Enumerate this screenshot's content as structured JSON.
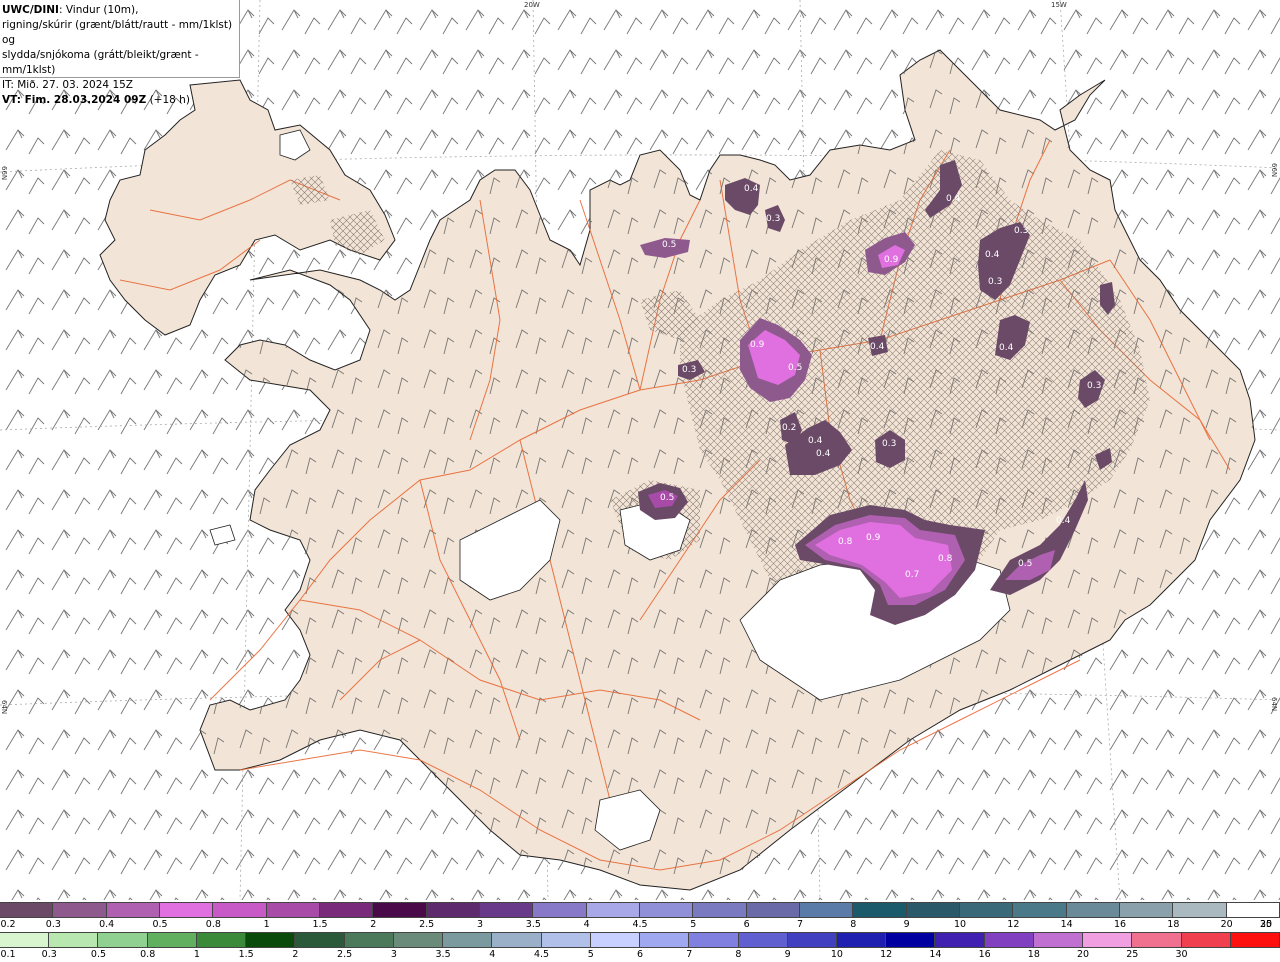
{
  "infobox": {
    "model": "UWC/DINI",
    "line1_rest": ": Vindur (10m),",
    "line2": "rigning/skúrir (grænt/blátt/rautt - mm/1klst) og",
    "line3": "slydda/snjókoma (grátt/bleikt/grænt - mm/1klst)",
    "line4": "IT: Mið. 27. 03. 2024 15Z",
    "line5": "VT: Fim. 28.03.2024 09Z",
    "line5_rest": " (+18 h)"
  },
  "grid_labels": {
    "lon_20w": "20W",
    "lon_15w": "15W",
    "lat_66n_left": "66N",
    "lat_66n_right": "66N",
    "lat_64n_left": "64N",
    "lat_64n_right": "64N"
  },
  "colors": {
    "land": "#f2e4d6",
    "sea": "#ffffff",
    "roads": "#e8602a",
    "hatch": "#8a7a70",
    "glacier": "#ffffff"
  },
  "precip_labels": [
    {
      "id": "p1",
      "text": "0.5"
    },
    {
      "id": "p2",
      "text": "0.4"
    },
    {
      "id": "p3",
      "text": "0.3"
    },
    {
      "id": "p4",
      "text": "0.9"
    },
    {
      "id": "p5",
      "text": "0.4"
    },
    {
      "id": "p6",
      "text": "0.3"
    },
    {
      "id": "p7",
      "text": "0.4"
    },
    {
      "id": "p8",
      "text": "0.3"
    },
    {
      "id": "p9",
      "text": "0.4"
    },
    {
      "id": "p10",
      "text": "0.3"
    },
    {
      "id": "p11",
      "text": "0.9"
    },
    {
      "id": "p12",
      "text": "0.5"
    },
    {
      "id": "p13",
      "text": "0.3"
    },
    {
      "id": "p14",
      "text": "0.2"
    },
    {
      "id": "p15",
      "text": "0.4"
    },
    {
      "id": "p16",
      "text": "0.4"
    },
    {
      "id": "p17",
      "text": "0.3"
    },
    {
      "id": "p18",
      "text": "0.4"
    },
    {
      "id": "p19",
      "text": "0.8"
    },
    {
      "id": "p20",
      "text": "0.9"
    },
    {
      "id": "p21",
      "text": "0.7"
    },
    {
      "id": "p22",
      "text": "0.8"
    },
    {
      "id": "p23",
      "text": "0.4"
    },
    {
      "id": "p24",
      "text": "0.5"
    },
    {
      "id": "p25",
      "text": "0.5"
    }
  ],
  "legend_snow": {
    "colors": [
      "#6b4a68",
      "#8e5a8e",
      "#b060b0",
      "#e070e0",
      "#c85ac8",
      "#a84aa8",
      "#7a2a7a",
      "#4a0a4a",
      "#5e2a6e",
      "#6a3a8a",
      "#8878c8",
      "#a8a8e8",
      "#9090d8",
      "#7a7ac0",
      "#6a6aa8",
      "#5a7aa8",
      "#1a5a6a",
      "#2a5a6a",
      "#3a6a7a",
      "#4a7a8a",
      "#6a8a9a",
      "#8aa0aa",
      "#aab8c0",
      "#ffffff"
    ],
    "ticks": [
      "0.2",
      "0.3",
      "0.4",
      "0.5",
      "0.8",
      "1",
      "1.5",
      "2",
      "2.5",
      "3",
      "3.5",
      "4",
      "4.5",
      "5",
      "6",
      "7",
      "8",
      "9",
      "10",
      "12",
      "14",
      "16",
      "18",
      "20",
      "25",
      "30"
    ]
  },
  "legend_rain": {
    "colors": [
      "#d8f5d0",
      "#b8e8b0",
      "#90d090",
      "#60b060",
      "#3a8a3a",
      "#0a4a0a",
      "#2a5a3a",
      "#4a7a5a",
      "#6a8a7a",
      "#7a9aa0",
      "#9ab0c8",
      "#b0c0e8",
      "#c8d0ff",
      "#a0a8f0",
      "#8080e0",
      "#6060d0",
      "#4040c0",
      "#2020b0",
      "#0000a0",
      "#4020b0",
      "#8040c0",
      "#c070d0",
      "#f0a0e0",
      "#f07090",
      "#f04050",
      "#ff1010"
    ],
    "ticks": [
      "0.1",
      "0.3",
      "0.5",
      "0.8",
      "1",
      "1.5",
      "2",
      "2.5",
      "3",
      "3.5",
      "4",
      "4.5",
      "5",
      "6",
      "7",
      "8",
      "9",
      "10",
      "12",
      "14",
      "16",
      "18",
      "20",
      "25",
      "30"
    ]
  }
}
